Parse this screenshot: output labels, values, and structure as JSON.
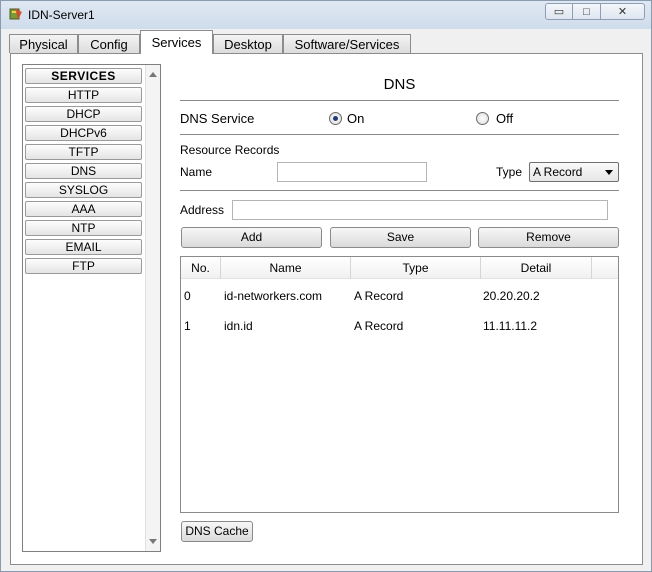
{
  "window": {
    "title": "IDN-Server1",
    "controls": {
      "minimize": "▭",
      "maximize": "□",
      "close": "✕"
    }
  },
  "tabs": [
    {
      "label": "Physical",
      "active": false
    },
    {
      "label": "Config",
      "active": false
    },
    {
      "label": "Services",
      "active": true
    },
    {
      "label": "Desktop",
      "active": false
    },
    {
      "label": "Software/Services",
      "active": false
    }
  ],
  "sidebar": {
    "header": "SERVICES",
    "items": [
      "HTTP",
      "DHCP",
      "DHCPv6",
      "TFTP",
      "DNS",
      "SYSLOG",
      "AAA",
      "NTP",
      "EMAIL",
      "FTP"
    ]
  },
  "dns": {
    "title": "DNS",
    "service_label": "DNS Service",
    "on_label": "On",
    "off_label": "Off",
    "selected": "On",
    "resource_records_label": "Resource Records",
    "name_label": "Name",
    "name_value": "",
    "type_label": "Type",
    "type_value": "A Record",
    "address_label": "Address",
    "address_value": "",
    "buttons": {
      "add": "Add",
      "save": "Save",
      "remove": "Remove"
    },
    "table": {
      "columns": [
        "No.",
        "Name",
        "Type",
        "Detail"
      ],
      "rows": [
        {
          "no": "0",
          "name": "id-networkers.com",
          "type": "A Record",
          "detail": "20.20.20.2"
        },
        {
          "no": "1",
          "name": "idn.id",
          "type": "A Record",
          "detail": "11.11.11.2"
        }
      ]
    },
    "cache_button": "DNS Cache"
  }
}
